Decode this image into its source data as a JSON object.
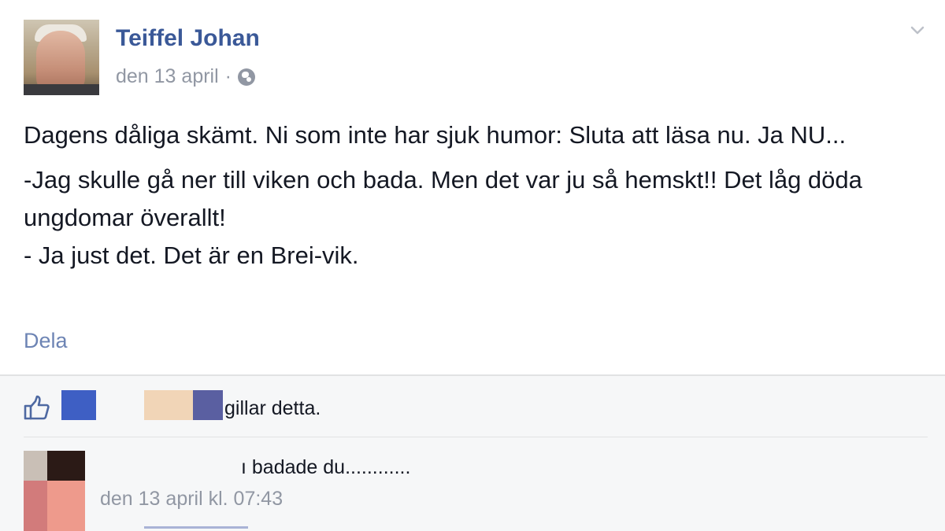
{
  "post": {
    "author": "Teiffel Johan",
    "date": "den 13 april",
    "separator": "·",
    "audience_icon": "globe-icon",
    "paragraphs": [
      "Dagens dåliga skämt. Ni som inte har sjuk humor: Sluta att läsa nu. Ja NU...",
      "-Jag skulle gå ner till viken och bada. Men det var ju så hemskt!! Det låg döda ungdomar överallt!",
      "- Ja just det. Det är en Brei-vik."
    ],
    "share_label": "Dela",
    "menu_icon": "chevron-down-icon"
  },
  "feedback": {
    "like_icon": "thumbs-up-icon",
    "likes_text": "gillar detta."
  },
  "comment": {
    "text": "ı badade du............",
    "timestamp": "den 13 april kl. 07:43"
  },
  "colors": {
    "link": "#3b5998",
    "share": "#6d84b4",
    "meta": "#9197a3",
    "feedback_bg": "#f6f7f8"
  }
}
